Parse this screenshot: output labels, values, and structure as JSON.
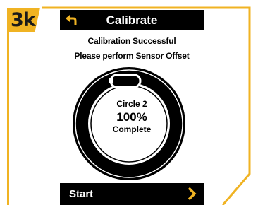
{
  "step": {
    "label": "3k"
  },
  "header": {
    "title": "Calibrate",
    "back_icon": "back-arrow-icon"
  },
  "status": {
    "line1": "Calibration Successful",
    "line2": "Please perform Sensor Offset"
  },
  "progress": {
    "circle_label": "Circle 2",
    "percent_text": "100%",
    "complete_text": "Complete",
    "fraction": 1.0
  },
  "footer": {
    "start_label": "Start",
    "chevron_icon": "chevron-right-icon"
  },
  "colors": {
    "accent": "#f0b323",
    "screen_bg": "#000000",
    "text": "#ffffff"
  }
}
